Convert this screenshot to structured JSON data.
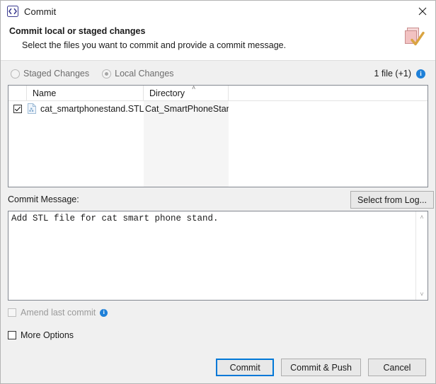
{
  "window": {
    "title": "Commit",
    "icon": "code-brackets-icon",
    "close_label": "✕"
  },
  "header": {
    "title": "Commit local or staged changes",
    "subtitle": "Select the files you want to commit and provide a commit message.",
    "graphic": "commit-files-check-icon"
  },
  "scope": {
    "options": [
      {
        "label": "Staged Changes",
        "selected": false,
        "disabled": true
      },
      {
        "label": "Local Changes",
        "selected": true,
        "disabled": true
      }
    ],
    "file_count": "1 file (+1)",
    "info_icon": "info-icon"
  },
  "file_table": {
    "columns": [
      {
        "key": "check",
        "label": ""
      },
      {
        "key": "name",
        "label": "Name"
      },
      {
        "key": "directory",
        "label": "Directory"
      }
    ],
    "sorted_by": "Directory",
    "sort_direction": "ascending",
    "sort_caret": "˄",
    "rows": [
      {
        "checked": true,
        "icon": "file-document-icon",
        "name": "cat_smartphonestand.STL",
        "directory": "Cat_SmartPhoneStand"
      }
    ]
  },
  "commit_message": {
    "label": "Commit Message:",
    "select_from_log_label": "Select from Log...",
    "value": "Add STL file for cat smart phone stand.",
    "scrollbar": {
      "up": "˄",
      "down": "˅"
    }
  },
  "options": {
    "amend": {
      "label": "Amend last commit",
      "checked": false,
      "disabled": true,
      "info_icon": "info-icon"
    },
    "more": {
      "label": "More Options",
      "checked": false,
      "disabled": false
    }
  },
  "footer": {
    "buttons": [
      {
        "label": "Commit",
        "default": true
      },
      {
        "label": "Commit & Push",
        "default": false
      },
      {
        "label": "Cancel",
        "default": false
      }
    ]
  },
  "colors": {
    "accent": "#0078d7",
    "info": "#1e80d8",
    "dialog_bg": "#f0f0f0",
    "panel_bg": "#ffffff",
    "sorted_column": "#f5f5f5",
    "title_icon": "#3b3b8f",
    "graphic_paper": "#f2c2c2",
    "graphic_check": "#d9a441"
  }
}
